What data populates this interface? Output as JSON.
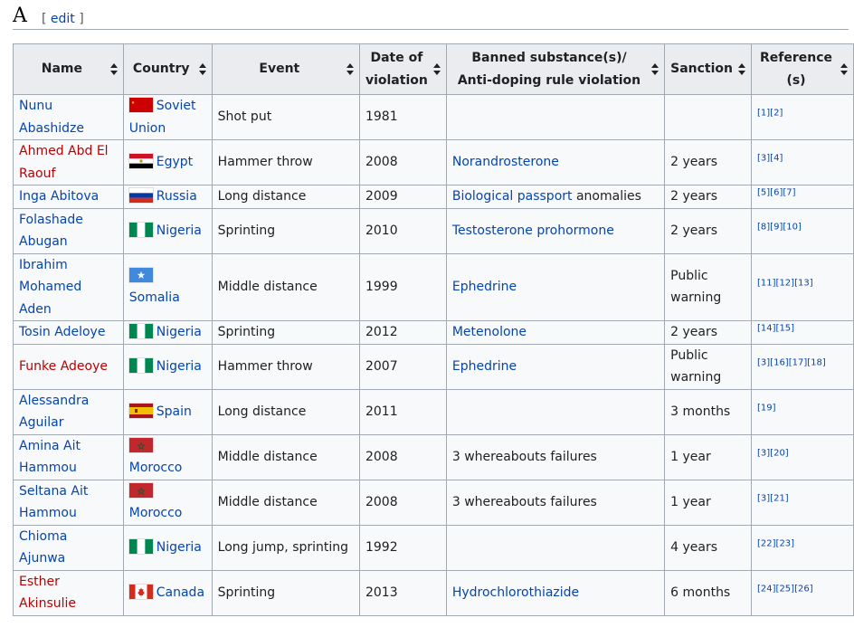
{
  "section": {
    "title": "A",
    "edit_open": "[ ",
    "edit_label": "edit",
    "edit_close": " ]"
  },
  "table": {
    "headers": [
      {
        "l1": "Name",
        "l2": ""
      },
      {
        "l1": "Country",
        "l2": ""
      },
      {
        "l1": "Event",
        "l2": ""
      },
      {
        "l1": "Date of",
        "l2": "violation"
      },
      {
        "l1": "Banned substance(s)/",
        "l2": "Anti-doping rule violation"
      },
      {
        "l1": "Sanction",
        "l2": ""
      },
      {
        "l1": "Reference",
        "l2": "(s)"
      }
    ],
    "rows": [
      {
        "name": "Nunu Abashidze",
        "name_link": "blue",
        "country": "Soviet Union",
        "flag": "soviet",
        "event": "Shot put",
        "date": "1981",
        "substance": "",
        "substance_suffix": "",
        "sanction": "",
        "refs": "[1][2]"
      },
      {
        "name": "Ahmed Abd El Raouf",
        "name_link": "red",
        "country": "Egypt",
        "flag": "egypt",
        "event": "Hammer throw",
        "date": "2008",
        "substance": "Norandrosterone",
        "substance_suffix": "",
        "sanction": "2 years",
        "refs": "[3][4]"
      },
      {
        "name": "Inga Abitova",
        "name_link": "blue",
        "country": "Russia",
        "flag": "russia",
        "event": "Long distance",
        "date": "2009",
        "substance": "Biological passport",
        "substance_suffix": " anomalies",
        "sanction": "2 years",
        "refs": "[5][6][7]"
      },
      {
        "name": "Folashade Abugan",
        "name_link": "blue",
        "country": "Nigeria",
        "flag": "nigeria",
        "event": "Sprinting",
        "date": "2010",
        "substance": "Testosterone prohormone",
        "substance_suffix": "",
        "sanction": "2 years",
        "refs": "[8][9][10]"
      },
      {
        "name": "Ibrahim Mohamed Aden",
        "name_link": "blue",
        "country": "Somalia",
        "flag": "somalia",
        "event": "Middle distance",
        "date": "1999",
        "substance": "Ephedrine",
        "substance_suffix": "",
        "sanction": "Public warning",
        "refs": "[11][12][13]"
      },
      {
        "name": "Tosin Adeloye",
        "name_link": "blue",
        "country": "Nigeria",
        "flag": "nigeria",
        "event": "Sprinting",
        "date": "2012",
        "substance": "Metenolone",
        "substance_suffix": "",
        "sanction": "2 years",
        "refs": "[14][15]"
      },
      {
        "name": "Funke Adeoye",
        "name_link": "red",
        "country": "Nigeria",
        "flag": "nigeria",
        "event": "Hammer throw",
        "date": "2007",
        "substance": "Ephedrine",
        "substance_suffix": "",
        "sanction": "Public warning",
        "refs": "[3][16][17][18]"
      },
      {
        "name": "Alessandra Aguilar",
        "name_link": "blue",
        "country": "Spain",
        "flag": "spain",
        "event": "Long distance",
        "date": "2011",
        "substance": "",
        "substance_suffix": "",
        "sanction": "3 months",
        "refs": "[19]"
      },
      {
        "name": "Amina Ait Hammou",
        "name_link": "blue",
        "country": "Morocco",
        "flag": "morocco",
        "event": "Middle distance",
        "date": "2008",
        "substance": "",
        "substance_suffix": "3 whereabouts failures",
        "sanction": "1 year",
        "refs": "[3][20]"
      },
      {
        "name": "Seltana Ait Hammou",
        "name_link": "blue",
        "country": "Morocco",
        "flag": "morocco",
        "event": "Middle distance",
        "date": "2008",
        "substance": "",
        "substance_suffix": "3 whereabouts failures",
        "sanction": "1 year",
        "refs": "[3][21]"
      },
      {
        "name": "Chioma Ajunwa",
        "name_link": "blue",
        "country": "Nigeria",
        "flag": "nigeria",
        "event": "Long jump, sprinting",
        "date": "1992",
        "substance": "",
        "substance_suffix": "",
        "sanction": "4 years",
        "refs": "[22][23]"
      },
      {
        "name": "Esther Akinsulie",
        "name_link": "red",
        "country": "Canada",
        "flag": "canada",
        "event": "Sprinting",
        "date": "2013",
        "substance": "Hydrochlorothiazide",
        "substance_suffix": "",
        "sanction": "6 months",
        "refs": "[24][25][26]"
      }
    ]
  },
  "colors": {
    "link": "#0645ad",
    "redlink": "#ba0000",
    "border": "#a2a9b1",
    "header_bg": "#eaecf0",
    "cell_bg": "#f8f9fa"
  }
}
